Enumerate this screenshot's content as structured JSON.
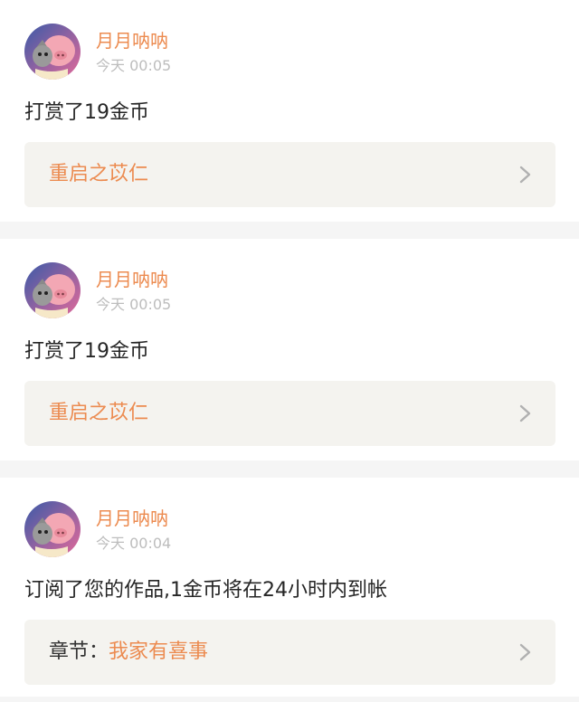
{
  "feed": [
    {
      "user_name": "月月呐呐",
      "time": "今天 00:05",
      "action": "打赏了19金币",
      "target_prefix": "",
      "target_title": "重启之苡仁",
      "chevron_icon": "chevron-right-icon"
    },
    {
      "user_name": "月月呐呐",
      "time": "今天 00:05",
      "action": "打赏了19金币",
      "target_prefix": "",
      "target_title": "重启之苡仁",
      "chevron_icon": "chevron-right-icon"
    },
    {
      "user_name": "月月呐呐",
      "time": "今天 00:04",
      "action": "订阅了您的作品,1金币将在24小时内到帐",
      "target_prefix": "章节：",
      "target_title": "我家有喜事",
      "chevron_icon": "chevron-right-icon"
    }
  ],
  "colors": {
    "accent": "#ec8b50",
    "time_gray": "#bdbdbd",
    "card_bg": "#ffffff",
    "target_bg": "#f4f3ef",
    "page_bg": "#f5f5f5"
  }
}
